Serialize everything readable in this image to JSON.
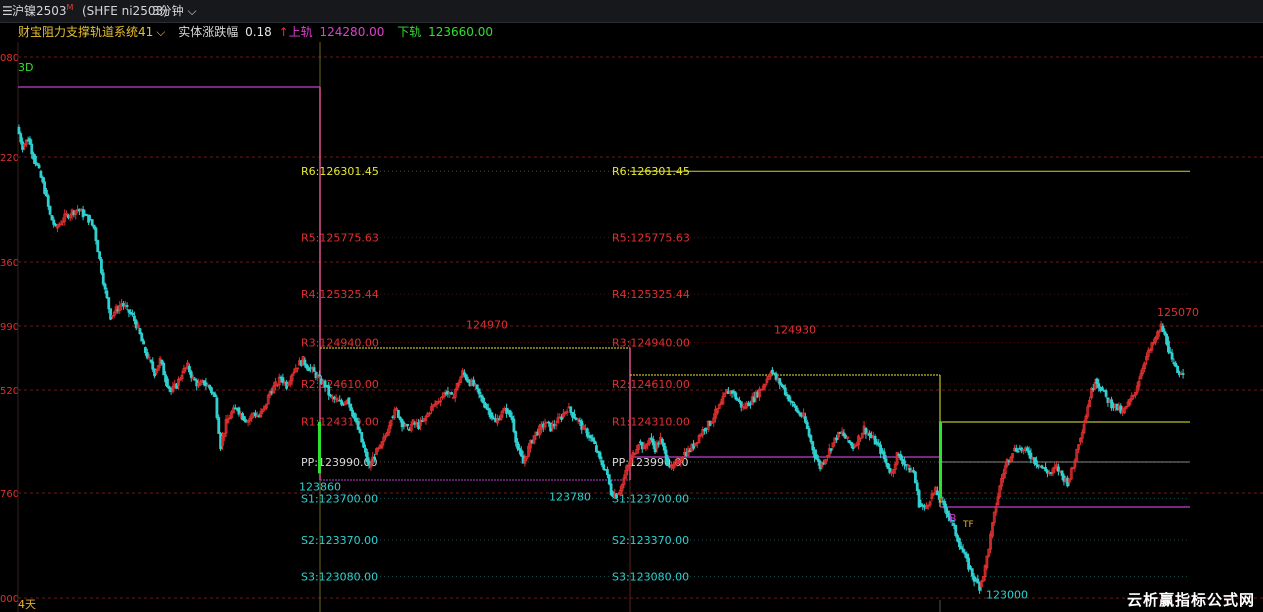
{
  "header": {
    "symbol": "沪镍2503",
    "symbol_sup": "M",
    "code": "(SHFE ni2503)",
    "period": "3分钟"
  },
  "indicator": {
    "name": "财宝阻力支撑轨道系统41",
    "amp_label": "实体涨跌幅",
    "amp_value": "0.18",
    "upper_label": "上轨",
    "upper_value": "124280.00",
    "lower_label": "下轨",
    "lower_value": "123660.00"
  },
  "footer": {
    "days": "4天",
    "watermark": "云析赢指标公式网"
  },
  "colors": {
    "background": "#000000",
    "up": "#e03030",
    "down": "#30d0d0",
    "resistance": "#e03030",
    "support": "#30d0d0",
    "r6": "#e8e830",
    "grid_red": "#6a1a1a",
    "upper_rail": "#e8e830",
    "lower_rail": "#c040d0",
    "pink_rail": "#e05090"
  },
  "chart_data": {
    "type": "candlestick",
    "y_tick_labels": [
      "080",
      "220",
      "360",
      "990",
      "520",
      "760",
      "000"
    ],
    "pivot_levels": [
      {
        "label": "R6:126301.45",
        "value": 126301.45
      },
      {
        "label": "R5:125775.63",
        "value": 125775.63
      },
      {
        "label": "R4:125325.44",
        "value": 125325.44
      },
      {
        "label": "R3:124940.00",
        "value": 124940.0
      },
      {
        "label": "R2:124610.00",
        "value": 124610.0
      },
      {
        "label": "R1:124310.00",
        "value": 124310.0
      },
      {
        "label": "PP:123990.00",
        "value": 123990.0
      },
      {
        "label": "S1:123700.00",
        "value": 123700.0
      },
      {
        "label": "S2:123370.00",
        "value": 123370.0
      },
      {
        "label": "S3:123080.00",
        "value": 123080.0
      }
    ],
    "annotations": [
      {
        "text": "124970",
        "value": 124970,
        "color": "#e03030"
      },
      {
        "text": "124930",
        "value": 124930,
        "color": "#e03030"
      },
      {
        "text": "125070",
        "value": 125070,
        "color": "#e03030"
      },
      {
        "text": "123860",
        "value": 123860,
        "color": "#30d0d0"
      },
      {
        "text": "123780",
        "value": 123780,
        "color": "#30d0d0"
      },
      {
        "text": "123000",
        "value": 123000,
        "color": "#30d0d0"
      }
    ],
    "signals": [
      {
        "text": "3D",
        "color": "#30e030"
      },
      {
        "text": "B",
        "color": "#c040d0"
      },
      {
        "text": "TF",
        "color": "#e6b030"
      }
    ],
    "price_path": [
      [
        0,
        126650
      ],
      [
        2,
        126500
      ],
      [
        4,
        126560
      ],
      [
        6,
        126420
      ],
      [
        8,
        126300
      ],
      [
        10,
        126150
      ],
      [
        12,
        125950
      ],
      [
        14,
        125850
      ],
      [
        16,
        125900
      ],
      [
        18,
        125950
      ],
      [
        20,
        125980
      ],
      [
        22,
        126000
      ],
      [
        24,
        125960
      ],
      [
        26,
        125920
      ],
      [
        28,
        125850
      ],
      [
        30,
        125600
      ],
      [
        32,
        125350
      ],
      [
        34,
        125150
      ],
      [
        36,
        125200
      ],
      [
        38,
        125250
      ],
      [
        40,
        125200
      ],
      [
        42,
        125150
      ],
      [
        44,
        125050
      ],
      [
        46,
        124900
      ],
      [
        48,
        124800
      ],
      [
        50,
        124700
      ],
      [
        52,
        124800
      ],
      [
        54,
        124650
      ],
      [
        56,
        124550
      ],
      [
        58,
        124600
      ],
      [
        60,
        124700
      ],
      [
        62,
        124750
      ],
      [
        64,
        124650
      ],
      [
        66,
        124600
      ],
      [
        68,
        124620
      ],
      [
        70,
        124580
      ],
      [
        72,
        124500
      ],
      [
        74,
        124120
      ],
      [
        76,
        124300
      ],
      [
        78,
        124380
      ],
      [
        80,
        124420
      ],
      [
        82,
        124350
      ],
      [
        84,
        124320
      ],
      [
        86,
        124380
      ],
      [
        88,
        124350
      ],
      [
        90,
        124420
      ],
      [
        92,
        124550
      ],
      [
        94,
        124600
      ],
      [
        96,
        124660
      ],
      [
        98,
        124600
      ],
      [
        100,
        124700
      ],
      [
        102,
        124760
      ],
      [
        104,
        124800
      ],
      [
        106,
        124740
      ],
      [
        108,
        124700
      ],
      [
        110,
        124650
      ],
      [
        112,
        124600
      ],
      [
        114,
        124500
      ],
      [
        116,
        124480
      ],
      [
        118,
        124450
      ],
      [
        120,
        124500
      ],
      [
        122,
        124380
      ],
      [
        124,
        124250
      ],
      [
        126,
        124100
      ],
      [
        128,
        123950
      ],
      [
        130,
        124050
      ],
      [
        132,
        124100
      ],
      [
        134,
        124200
      ],
      [
        136,
        124350
      ],
      [
        138,
        124400
      ],
      [
        140,
        124300
      ],
      [
        142,
        124250
      ],
      [
        144,
        124300
      ],
      [
        146,
        124280
      ],
      [
        148,
        124320
      ],
      [
        150,
        124400
      ],
      [
        152,
        124450
      ],
      [
        154,
        124500
      ],
      [
        156,
        124550
      ],
      [
        158,
        124500
      ],
      [
        160,
        124600
      ],
      [
        162,
        124700
      ],
      [
        164,
        124640
      ],
      [
        166,
        124600
      ],
      [
        168,
        124520
      ],
      [
        170,
        124450
      ],
      [
        172,
        124380
      ],
      [
        174,
        124300
      ],
      [
        176,
        124380
      ],
      [
        178,
        124400
      ],
      [
        180,
        124330
      ],
      [
        182,
        124100
      ],
      [
        184,
        123980
      ],
      [
        186,
        124100
      ],
      [
        188,
        124200
      ],
      [
        190,
        124250
      ],
      [
        192,
        124300
      ],
      [
        194,
        124260
      ],
      [
        196,
        124300
      ],
      [
        198,
        124350
      ],
      [
        200,
        124420
      ],
      [
        202,
        124370
      ],
      [
        204,
        124320
      ],
      [
        206,
        124250
      ],
      [
        208,
        124200
      ],
      [
        210,
        124120
      ],
      [
        212,
        124000
      ],
      [
        214,
        123930
      ],
      [
        216,
        123750
      ],
      [
        218,
        123730
      ],
      [
        220,
        123810
      ],
      [
        222,
        123950
      ],
      [
        224,
        124050
      ],
      [
        226,
        124150
      ],
      [
        228,
        124100
      ],
      [
        230,
        124180
      ],
      [
        232,
        124100
      ],
      [
        234,
        124170
      ],
      [
        236,
        124020
      ],
      [
        238,
        123940
      ],
      [
        240,
        123980
      ],
      [
        242,
        124050
      ],
      [
        244,
        124080
      ],
      [
        246,
        124120
      ],
      [
        248,
        124200
      ],
      [
        250,
        124260
      ],
      [
        252,
        124300
      ],
      [
        254,
        124380
      ],
      [
        256,
        124450
      ],
      [
        258,
        124550
      ],
      [
        260,
        124550
      ],
      [
        262,
        124480
      ],
      [
        264,
        124420
      ],
      [
        266,
        124460
      ],
      [
        268,
        124500
      ],
      [
        270,
        124560
      ],
      [
        272,
        124620
      ],
      [
        274,
        124720
      ],
      [
        276,
        124650
      ],
      [
        278,
        124600
      ],
      [
        280,
        124520
      ],
      [
        282,
        124450
      ],
      [
        284,
        124380
      ],
      [
        286,
        124350
      ],
      [
        288,
        124200
      ],
      [
        290,
        124050
      ],
      [
        292,
        123950
      ],
      [
        294,
        124030
      ],
      [
        296,
        124110
      ],
      [
        298,
        124190
      ],
      [
        300,
        124220
      ],
      [
        302,
        124160
      ],
      [
        304,
        124110
      ],
      [
        306,
        124180
      ],
      [
        308,
        124260
      ],
      [
        310,
        124200
      ],
      [
        312,
        124150
      ],
      [
        314,
        124080
      ],
      [
        316,
        123980
      ],
      [
        318,
        123900
      ],
      [
        320,
        124050
      ],
      [
        322,
        124000
      ],
      [
        324,
        123940
      ],
      [
        326,
        123910
      ],
      [
        328,
        123660
      ],
      [
        330,
        123620
      ],
      [
        332,
        123700
      ],
      [
        334,
        123760
      ],
      [
        336,
        123680
      ],
      [
        338,
        123600
      ],
      [
        340,
        123500
      ],
      [
        342,
        123380
      ],
      [
        344,
        123270
      ],
      [
        346,
        123160
      ],
      [
        348,
        123060
      ],
      [
        350,
        123000
      ],
      [
        352,
        123150
      ],
      [
        354,
        123400
      ],
      [
        356,
        123650
      ],
      [
        358,
        123860
      ],
      [
        360,
        124000
      ],
      [
        362,
        124080
      ],
      [
        364,
        124100
      ],
      [
        366,
        124080
      ],
      [
        368,
        124060
      ],
      [
        370,
        124000
      ],
      [
        372,
        123960
      ],
      [
        374,
        123920
      ],
      [
        376,
        123900
      ],
      [
        378,
        123950
      ],
      [
        380,
        123880
      ],
      [
        382,
        123830
      ],
      [
        384,
        123950
      ],
      [
        386,
        124150
      ],
      [
        388,
        124300
      ],
      [
        390,
        124500
      ],
      [
        392,
        124650
      ],
      [
        394,
        124580
      ],
      [
        396,
        124500
      ],
      [
        398,
        124450
      ],
      [
        400,
        124420
      ],
      [
        402,
        124380
      ],
      [
        404,
        124450
      ],
      [
        406,
        124520
      ],
      [
        408,
        124650
      ],
      [
        410,
        124800
      ],
      [
        412,
        124880
      ],
      [
        414,
        124970
      ],
      [
        416,
        125070
      ],
      [
        418,
        124950
      ],
      [
        420,
        124780
      ],
      [
        422,
        124700
      ],
      [
        424,
        124720
      ]
    ]
  }
}
